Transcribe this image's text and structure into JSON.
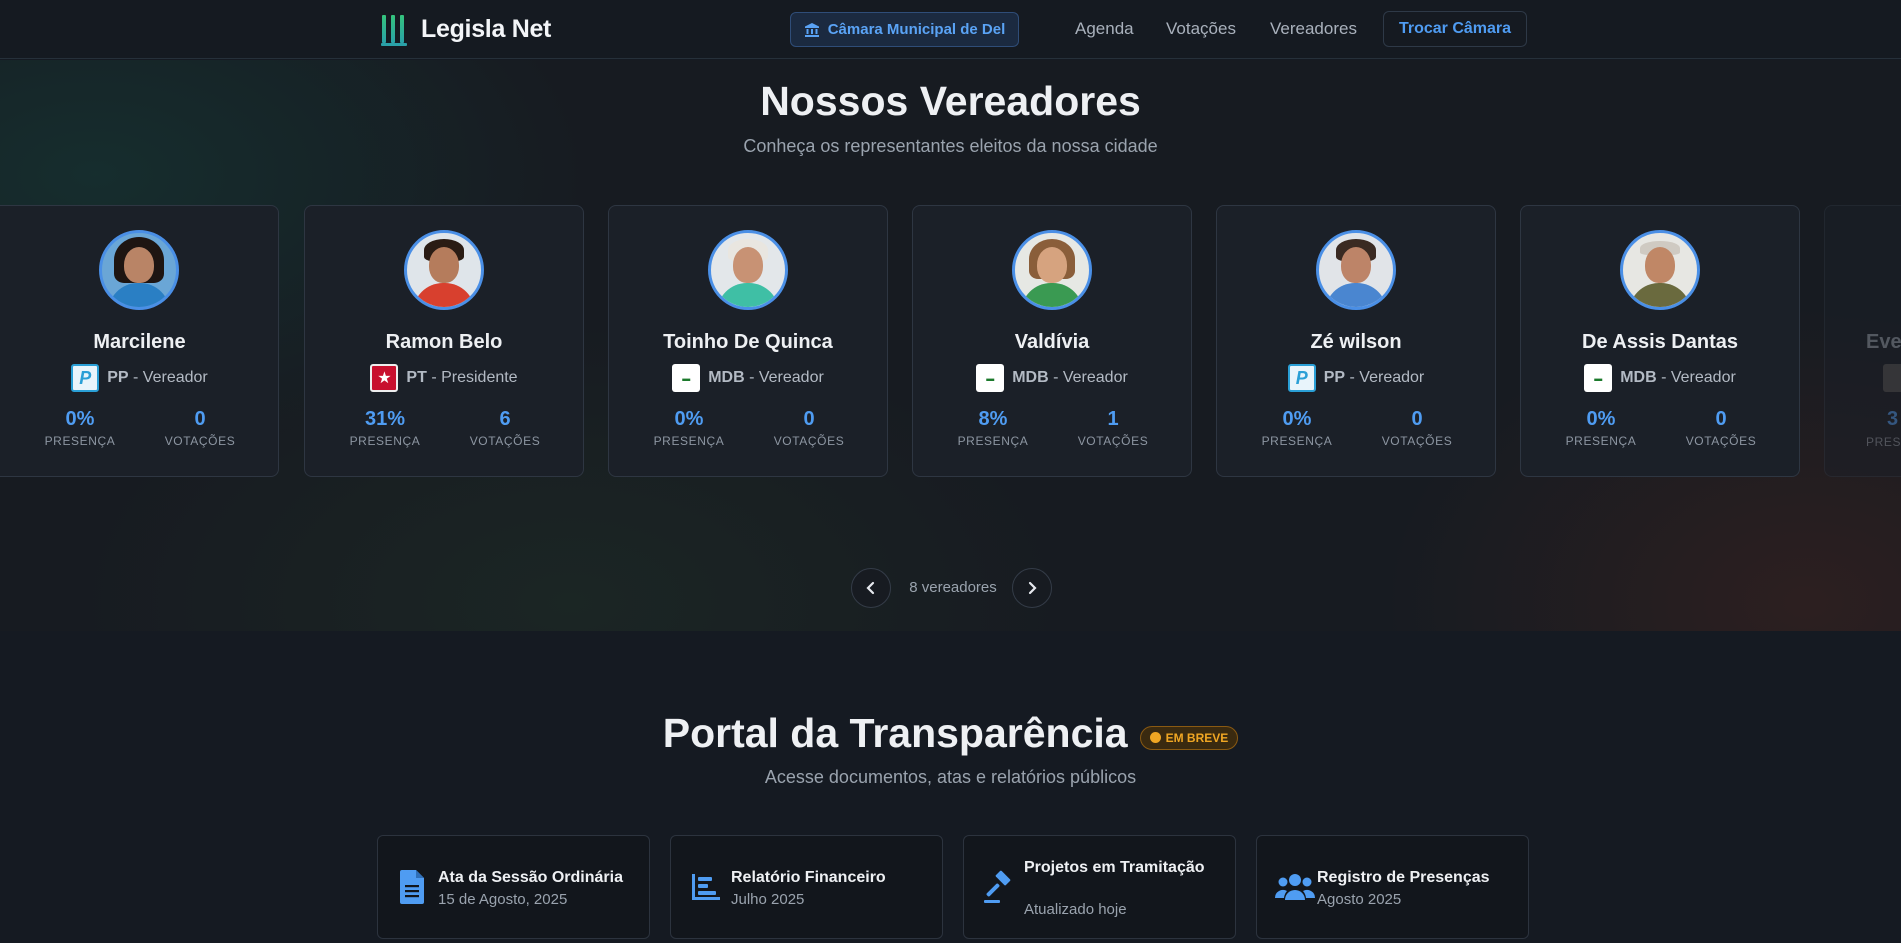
{
  "nav": {
    "brand": "Legisla Net",
    "chamber": "Câmara Municipal de Del",
    "links": [
      "Agenda",
      "Votações",
      "Vereadores"
    ],
    "switch_label": "Trocar Câmara"
  },
  "councilors_section": {
    "title": "Nossos Vereadores",
    "subtitle": "Conheça os representantes eleitos da nossa cidade",
    "presence_label": "PRESENÇA",
    "votes_label": "VOTAÇÕES",
    "cards": [
      {
        "name": "Marcilene",
        "party": "PP",
        "role": "- Vereador",
        "presence": "0%",
        "votes": "0"
      },
      {
        "name": "Ramon Belo",
        "party": "PT",
        "role": "- Presidente",
        "presence": "31%",
        "votes": "6"
      },
      {
        "name": "Toinho De Quinca",
        "party": "MDB",
        "role": "- Vereador",
        "presence": "0%",
        "votes": "0"
      },
      {
        "name": "Valdívia",
        "party": "MDB",
        "role": "- Vereador",
        "presence": "8%",
        "votes": "1"
      },
      {
        "name": "Zé wilson",
        "party": "PP",
        "role": "- Vereador",
        "presence": "0%",
        "votes": "0"
      },
      {
        "name": "De Assis Dantas",
        "party": "MDB",
        "role": "- Vereador",
        "presence": "0%",
        "votes": "0"
      },
      {
        "name": "Eve",
        "presence": "3",
        "presence_label_partial": "PRES"
      }
    ],
    "count_label": "8 vereadores"
  },
  "transparency": {
    "title": "Portal da Transparência",
    "badge": "EM BREVE",
    "subtitle": "Acesse documentos, atas e relatórios públicos",
    "items": [
      {
        "title": "Ata da Sessão Ordinária",
        "subtitle": "15 de Agosto, 2025",
        "icon": "document-icon"
      },
      {
        "title": "Relatório Financeiro",
        "subtitle": "Julho 2025",
        "icon": "bar-chart-icon"
      },
      {
        "title": "Projetos em Tramitação",
        "subtitle": "Atualizado hoje",
        "icon": "gavel-icon"
      },
      {
        "title": "Registro de Presenças",
        "subtitle": "Agosto 2025",
        "icon": "users-icon"
      }
    ]
  },
  "colors": {
    "accent": "#4f9cf2",
    "badge": "#f0a623",
    "background": "#151a22"
  }
}
